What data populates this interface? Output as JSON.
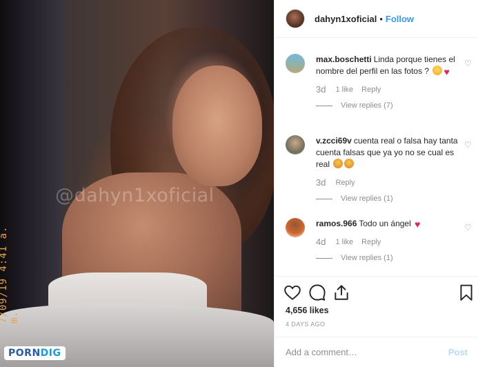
{
  "photo": {
    "watermark": "@dahyn1xoficial",
    "timestamp": "7/09/19 4:41 a. m.",
    "brand_left": "PORN",
    "brand_right": "DIG"
  },
  "header": {
    "username": "dahyn1xoficial",
    "separator": "•",
    "follow_label": "Follow"
  },
  "comments": [
    {
      "username": "max.boschetti",
      "text": "Linda porque tienes el nombre del perfil en las fotos ?",
      "emojis": [
        "smirk-face",
        "heart"
      ],
      "time": "3d",
      "likes": "1 like",
      "reply_label": "Reply",
      "view_replies": "View replies (7)"
    },
    {
      "username": "v.zcci69v",
      "text": "cuenta real o falsa hay tanta cuenta falsas que ya yo no se cual es real",
      "emojis": [
        "confused-face",
        "angry-face"
      ],
      "time": "3d",
      "likes": "",
      "reply_label": "Reply",
      "view_replies": "View replies (1)"
    },
    {
      "username": "ramos.966",
      "text": "Todo un ángel",
      "emojis": [
        "red-heart"
      ],
      "time": "4d",
      "likes": "1 like",
      "reply_label": "Reply",
      "view_replies": "View replies (1)"
    }
  ],
  "actions": {
    "icons": [
      "heart-icon",
      "comment-icon",
      "share-icon",
      "bookmark-icon"
    ],
    "likes_count": "4,656 likes",
    "date": "4 DAYS AGO"
  },
  "add_comment": {
    "placeholder": "Add a comment…",
    "post_label": "Post"
  },
  "colors": {
    "accent": "#3897f0",
    "post_disabled": "#b3dbff",
    "muted": "#8e8e8e",
    "text": "#262626"
  }
}
